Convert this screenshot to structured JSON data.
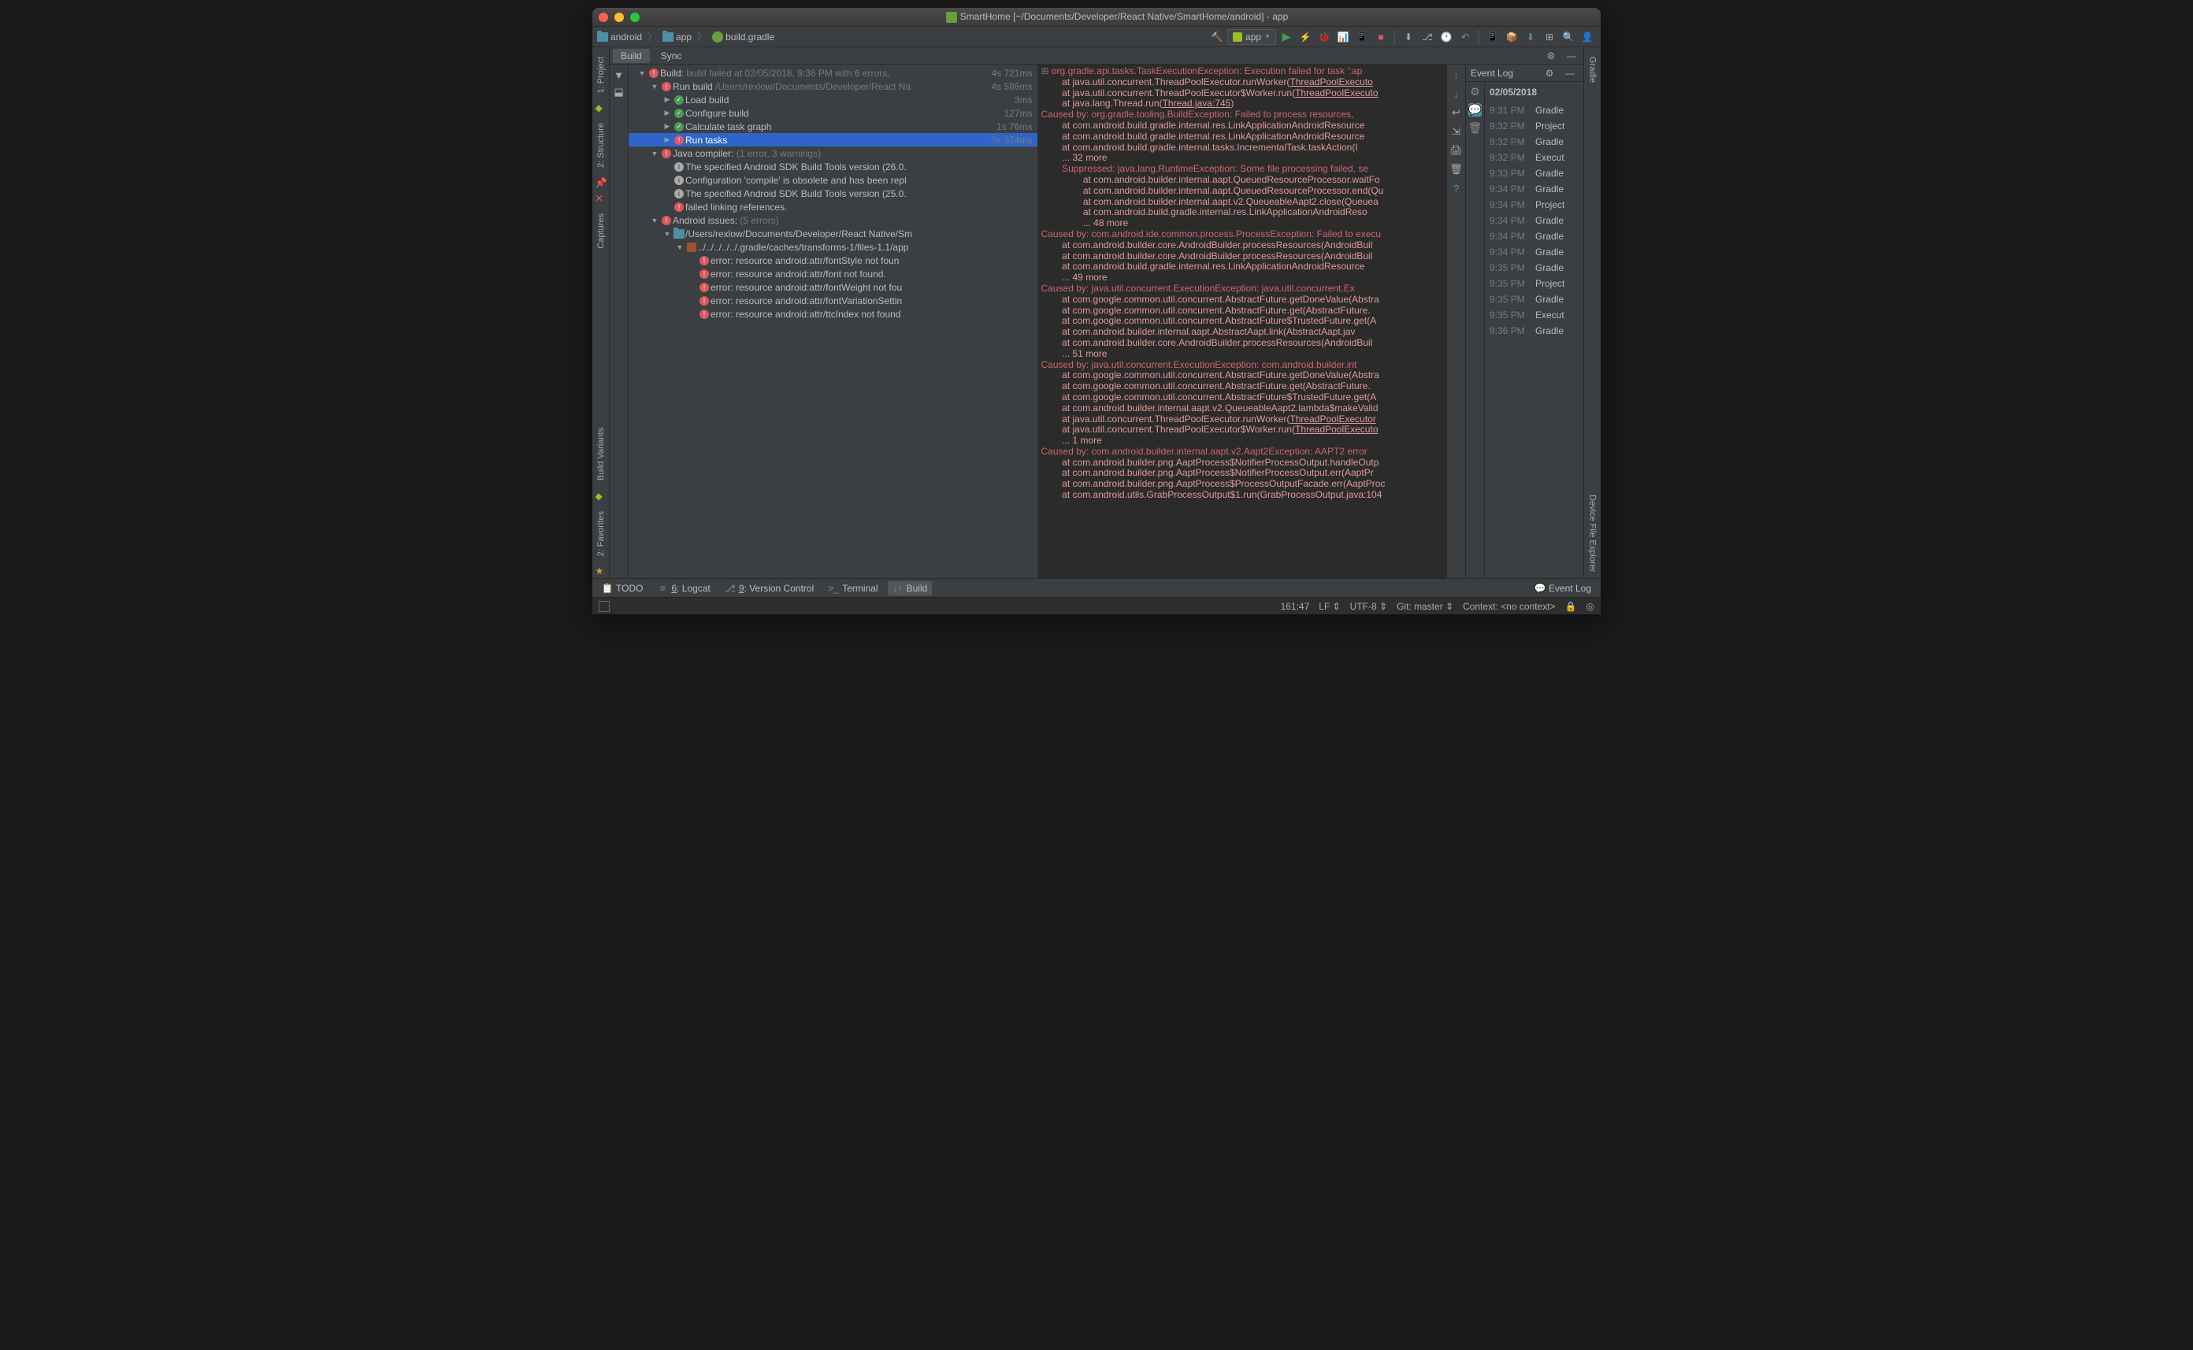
{
  "titlebar": {
    "project": "SmartHome",
    "title": "SmartHome [~/Documents/Developer/React Native/SmartHome/android] - app"
  },
  "breadcrumb": [
    {
      "icon": "folder",
      "label": "android"
    },
    {
      "icon": "folder",
      "label": "app"
    },
    {
      "icon": "gradle",
      "label": "build.gradle"
    }
  ],
  "runconfig": {
    "label": "app"
  },
  "panel_tabs": {
    "build": "Build",
    "sync": "Sync"
  },
  "left_tabs": [
    "1: Project",
    "2: Structure",
    "Captures",
    "Build Variants",
    "2: Favorites"
  ],
  "right_tabs": [
    "Gradle",
    "Device File Explorer"
  ],
  "build_tree": [
    {
      "depth": 0,
      "toggle": "▼",
      "icon": "err",
      "text": "Build:",
      "sub": " build failed",
      "extra": "at 02/05/2018, 9:36 PM   with 6 errors,",
      "time": "4s 721ms"
    },
    {
      "depth": 1,
      "toggle": "▼",
      "icon": "err",
      "text": "Run build",
      "sub": " /Users/rexlow/Documents/Developer/React Na",
      "time": "4s 586ms"
    },
    {
      "depth": 2,
      "toggle": "▶",
      "icon": "ok",
      "text": "Load build",
      "time": "3ms"
    },
    {
      "depth": 2,
      "toggle": "▶",
      "icon": "ok",
      "text": "Configure build",
      "time": "127ms"
    },
    {
      "depth": 2,
      "toggle": "▶",
      "icon": "ok",
      "text": "Calculate task graph",
      "time": "1s 76ms"
    },
    {
      "depth": 2,
      "toggle": "▶",
      "icon": "err",
      "text": "Run tasks",
      "time": "3s 374ms",
      "selected": true
    },
    {
      "depth": 1,
      "toggle": "▼",
      "icon": "err",
      "text": "Java compiler:",
      "sub": "   (1 error, 3 warnings)"
    },
    {
      "depth": 2,
      "icon": "info",
      "text": "The specified Android SDK Build Tools version (26.0."
    },
    {
      "depth": 2,
      "icon": "info",
      "text": "Configuration 'compile' is obsolete and has been repl"
    },
    {
      "depth": 2,
      "icon": "info",
      "text": "The specified Android SDK Build Tools version (25.0."
    },
    {
      "depth": 2,
      "icon": "err",
      "text": "failed linking references."
    },
    {
      "depth": 1,
      "toggle": "▼",
      "icon": "err",
      "text": "Android issues:",
      "sub": "   (5 errors)"
    },
    {
      "depth": 2,
      "toggle": "▼",
      "icon": "folder",
      "text": "/Users/rexlow/Documents/Developer/React Native/Sm"
    },
    {
      "depth": 3,
      "toggle": "▼",
      "icon": "file",
      "text": "../../../../../.gradle/caches/transforms-1/files-1.1/app"
    },
    {
      "depth": 4,
      "icon": "err",
      "text": "error: resource android:attr/fontStyle not foun"
    },
    {
      "depth": 4,
      "icon": "err",
      "text": "error: resource android:attr/font not found."
    },
    {
      "depth": 4,
      "icon": "err",
      "text": "error: resource android:attr/fontWeight not fou"
    },
    {
      "depth": 4,
      "icon": "err",
      "text": "error: resource android:attr/fontVariationSettin"
    },
    {
      "depth": 4,
      "icon": "err",
      "text": "error: resource android:attr/ttcIndex not found"
    }
  ],
  "log_lines": [
    {
      "c": "red",
      "t": "org.gradle.api.tasks.TaskExecutionException: Execution failed for task ':ap",
      "fold": "+"
    },
    {
      "c": "redlight",
      "t": "        at java.util.concurrent.ThreadPoolExecutor.runWorker(",
      "link": "ThreadPoolExecuto"
    },
    {
      "c": "redlight",
      "t": "        at java.util.concurrent.ThreadPoolExecutor$Worker.run(",
      "link": "ThreadPoolExecuto"
    },
    {
      "c": "redlight",
      "t": "        at java.lang.Thread.run(",
      "link": "Thread.java:745",
      "t2": ")"
    },
    {
      "c": "red",
      "t": "Caused by: org.gradle.tooling.BuildException: Failed to process resources, "
    },
    {
      "c": "redlight",
      "t": "        at com.android.build.gradle.internal.res.LinkApplicationAndroidResource"
    },
    {
      "c": "redlight",
      "t": "        at com.android.build.gradle.internal.res.LinkApplicationAndroidResource"
    },
    {
      "c": "redlight",
      "t": "        at com.android.build.gradle.internal.tasks.IncrementalTask.taskAction(I"
    },
    {
      "c": "redlight",
      "t": "        ... 32 more"
    },
    {
      "c": "red",
      "t": "        Suppressed: java.lang.RuntimeException: Some file processing failed, se"
    },
    {
      "c": "redlight",
      "t": "                at com.android.builder.internal.aapt.QueuedResourceProcessor.waitFo"
    },
    {
      "c": "redlight",
      "t": "                at com.android.builder.internal.aapt.QueuedResourceProcessor.end(Qu"
    },
    {
      "c": "redlight",
      "t": "                at com.android.builder.internal.aapt.v2.QueueableAapt2.close(Queuea"
    },
    {
      "c": "redlight",
      "t": "                at com.android.build.gradle.internal.res.LinkApplicationAndroidReso"
    },
    {
      "c": "redlight",
      "t": "                ... 48 more"
    },
    {
      "c": "red",
      "t": "Caused by: com.android.ide.common.process.ProcessException: Failed to execu"
    },
    {
      "c": "redlight",
      "t": "        at com.android.builder.core.AndroidBuilder.processResources(AndroidBuil"
    },
    {
      "c": "redlight",
      "t": "        at com.android.builder.core.AndroidBuilder.processResources(AndroidBuil"
    },
    {
      "c": "redlight",
      "t": "        at com.android.build.gradle.internal.res.LinkApplicationAndroidResource"
    },
    {
      "c": "redlight",
      "t": "        ... 49 more"
    },
    {
      "c": "red",
      "t": "Caused by: java.util.concurrent.ExecutionException: java.util.concurrent.Ex"
    },
    {
      "c": "redlight",
      "t": "        at com.google.common.util.concurrent.AbstractFuture.getDoneValue(Abstra"
    },
    {
      "c": "redlight",
      "t": "        at com.google.common.util.concurrent.AbstractFuture.get(AbstractFuture."
    },
    {
      "c": "redlight",
      "t": "        at com.google.common.util.concurrent.AbstractFuture$TrustedFuture.get(A"
    },
    {
      "c": "redlight",
      "t": "        at com.android.builder.internal.aapt.AbstractAapt.link(AbstractAapt.jav"
    },
    {
      "c": "redlight",
      "t": "        at com.android.builder.core.AndroidBuilder.processResources(AndroidBuil"
    },
    {
      "c": "redlight",
      "t": "        ... 51 more"
    },
    {
      "c": "red",
      "t": "Caused by: java.util.concurrent.ExecutionException: com.android.builder.int"
    },
    {
      "c": "redlight",
      "t": "        at com.google.common.util.concurrent.AbstractFuture.getDoneValue(Abstra"
    },
    {
      "c": "redlight",
      "t": "        at com.google.common.util.concurrent.AbstractFuture.get(AbstractFuture."
    },
    {
      "c": "redlight",
      "t": "        at com.google.common.util.concurrent.AbstractFuture$TrustedFuture.get(A"
    },
    {
      "c": "redlight",
      "t": "        at com.android.builder.internal.aapt.v2.QueueableAapt2.lambda$makeValid"
    },
    {
      "c": "redlight",
      "t": "        at java.util.concurrent.ThreadPoolExecutor.runWorker(",
      "link": "ThreadPoolExecutor"
    },
    {
      "c": "redlight",
      "t": "        at java.util.concurrent.ThreadPoolExecutor$Worker.run(",
      "link": "ThreadPoolExecuto"
    },
    {
      "c": "redlight",
      "t": "        ... 1 more"
    },
    {
      "c": "red",
      "t": "Caused by: com.android.builder.internal.aapt.v2.Aapt2Exception: AAPT2 error"
    },
    {
      "c": "redlight",
      "t": "        at com.android.builder.png.AaptProcess$NotifierProcessOutput.handleOutp"
    },
    {
      "c": "redlight",
      "t": "        at com.android.builder.png.AaptProcess$NotifierProcessOutput.err(AaptPr"
    },
    {
      "c": "redlight",
      "t": "        at com.android.builder.png.AaptProcess$ProcessOutputFacade.err(AaptProc"
    },
    {
      "c": "redlight",
      "t": "        at com.android.utils.GrabProcessOutput$1.run(GrabProcessOutput.java:104"
    }
  ],
  "event_log": {
    "title": "Event Log",
    "date": "02/05/2018",
    "rows": [
      {
        "t": "9:31 PM",
        "m": "Gradle"
      },
      {
        "t": "9:32 PM",
        "m": "Project"
      },
      {
        "t": "9:32 PM",
        "m": "Gradle"
      },
      {
        "t": "9:32 PM",
        "m": "Execut"
      },
      {
        "t": "9:33 PM",
        "m": "Gradle"
      },
      {
        "t": "9:34 PM",
        "m": "Gradle"
      },
      {
        "t": "9:34 PM",
        "m": "Project"
      },
      {
        "t": "9:34 PM",
        "m": "Gradle"
      },
      {
        "t": "9:34 PM",
        "m": "Gradle"
      },
      {
        "t": "9:34 PM",
        "m": "Gradle"
      },
      {
        "t": "9:35 PM",
        "m": "Gradle"
      },
      {
        "t": "9:35 PM",
        "m": "Project"
      },
      {
        "t": "9:35 PM",
        "m": "Gradle"
      },
      {
        "t": "9:35 PM",
        "m": "Execut"
      },
      {
        "t": "9:36 PM",
        "m": "Gradle"
      }
    ]
  },
  "bottom_tabs": [
    {
      "icon": "📋",
      "label": "TODO"
    },
    {
      "icon": "≡",
      "label": "6: Logcat",
      "u": true
    },
    {
      "icon": "⎇",
      "label": "9: Version Control",
      "u": true
    },
    {
      "icon": ">_",
      "label": "Terminal"
    },
    {
      "icon": "↓↑",
      "label": "Build",
      "active": true
    }
  ],
  "eventlog_btn": "Event Log",
  "status": {
    "pos": "161:47",
    "lf": "LF",
    "enc": "UTF-8",
    "git": "Git: master",
    "context": "Context: <no context>"
  }
}
